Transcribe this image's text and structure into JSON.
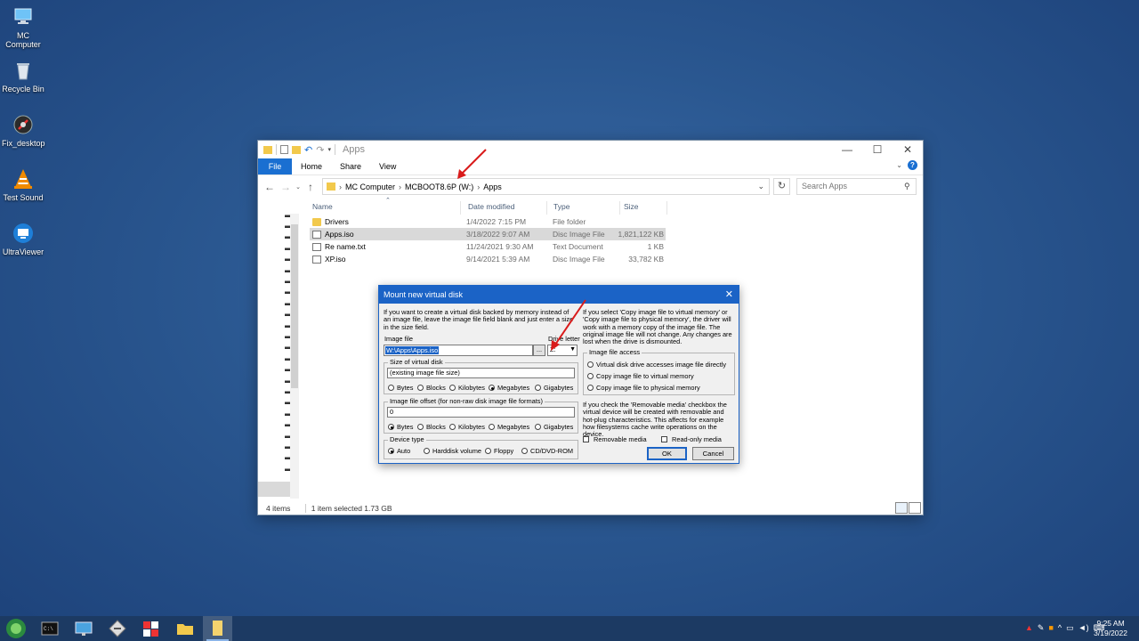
{
  "desktop": {
    "icons": [
      {
        "label": "MC\nComputer",
        "icon": "computer-icon"
      },
      {
        "label": "Recycle Bin",
        "icon": "recycle-bin-icon"
      },
      {
        "label": "Fix_desktop",
        "icon": "fix-desktop-icon"
      },
      {
        "label": "Test Sound",
        "icon": "vlc-icon"
      },
      {
        "label": "UltraViewer",
        "icon": "ultraviewer-icon"
      }
    ]
  },
  "explorer": {
    "title": "Apps",
    "ribbon_tabs": [
      "File",
      "Home",
      "Share",
      "View"
    ],
    "breadcrumb": [
      "MC Computer",
      "MCBOOT8.6P (W:)",
      "Apps"
    ],
    "search_placeholder": "Search Apps",
    "columns": [
      "Name",
      "Date modified",
      "Type",
      "Size"
    ],
    "files": [
      {
        "name": "Drivers",
        "date": "1/4/2022 7:15 PM",
        "type": "File folder",
        "size": "",
        "icon": "folder-icon",
        "selected": false
      },
      {
        "name": "Apps.iso",
        "date": "3/18/2022 9:07 AM",
        "type": "Disc Image File",
        "size": "1,821,122 KB",
        "icon": "disc-image-icon",
        "selected": true
      },
      {
        "name": "Re name.txt",
        "date": "11/24/2021 9:30 AM",
        "type": "Text Document",
        "size": "1 KB",
        "icon": "text-file-icon",
        "selected": false
      },
      {
        "name": "XP.iso",
        "date": "9/14/2021 5:39 AM",
        "type": "Disc Image File",
        "size": "33,782 KB",
        "icon": "disc-image-icon",
        "selected": false
      }
    ],
    "status": {
      "items": "4 items",
      "selection": "1 item selected  1.73 GB"
    }
  },
  "dialog": {
    "title": "Mount new virtual disk",
    "intro_left": "If you want to create a virtual disk backed by memory instead of an image file, leave the image file field blank and just enter a size in the size field.",
    "intro_right": "If you select 'Copy image file to virtual memory' or 'Copy image file to physical memory', the driver will work with a memory copy of the image file. The original image file will not change. Any changes are lost when the drive is dismounted.",
    "image_file_label": "Image file",
    "image_file_value": "W:\\Apps\\Apps.iso",
    "browse_label": "...",
    "drive_letter_label": "Drive letter",
    "drive_letter_value": "Z:",
    "size_group_label": "Size of virtual disk",
    "size_value": "(existing image file size)",
    "size_units": [
      "Bytes",
      "Blocks",
      "Kilobytes",
      "Megabytes",
      "Gigabytes"
    ],
    "size_unit_selected": "Megabytes",
    "offset_group_label": "Image file offset (for non-raw disk image file formats)",
    "offset_value": "0",
    "offset_units": [
      "Bytes",
      "Blocks",
      "Kilobytes",
      "Megabytes",
      "Gigabytes"
    ],
    "offset_unit_selected": "Bytes",
    "device_group_label": "Device type",
    "device_types": [
      "Auto",
      "Harddisk volume",
      "Floppy",
      "CD/DVD-ROM"
    ],
    "device_selected": "Auto",
    "access_group_label": "Image file access",
    "access_options": [
      "Virtual disk drive accesses image file directly",
      "Copy image file to virtual memory",
      "Copy image file to physical memory"
    ],
    "removable_text": "If you check the 'Removable media' checkbox the virtual device will be created with removable and hot-plug characteristics. This affects for example how filesystems cache write operations on the device.",
    "removable_label": "Removable media",
    "readonly_label": "Read-only media",
    "ok_label": "OK",
    "cancel_label": "Cancel"
  },
  "taskbar": {
    "time": "9:25 AM",
    "date": "3/19/2022"
  },
  "colors": {
    "accent": "#1b63c6",
    "annotation_arrow": "#d91b1b"
  }
}
